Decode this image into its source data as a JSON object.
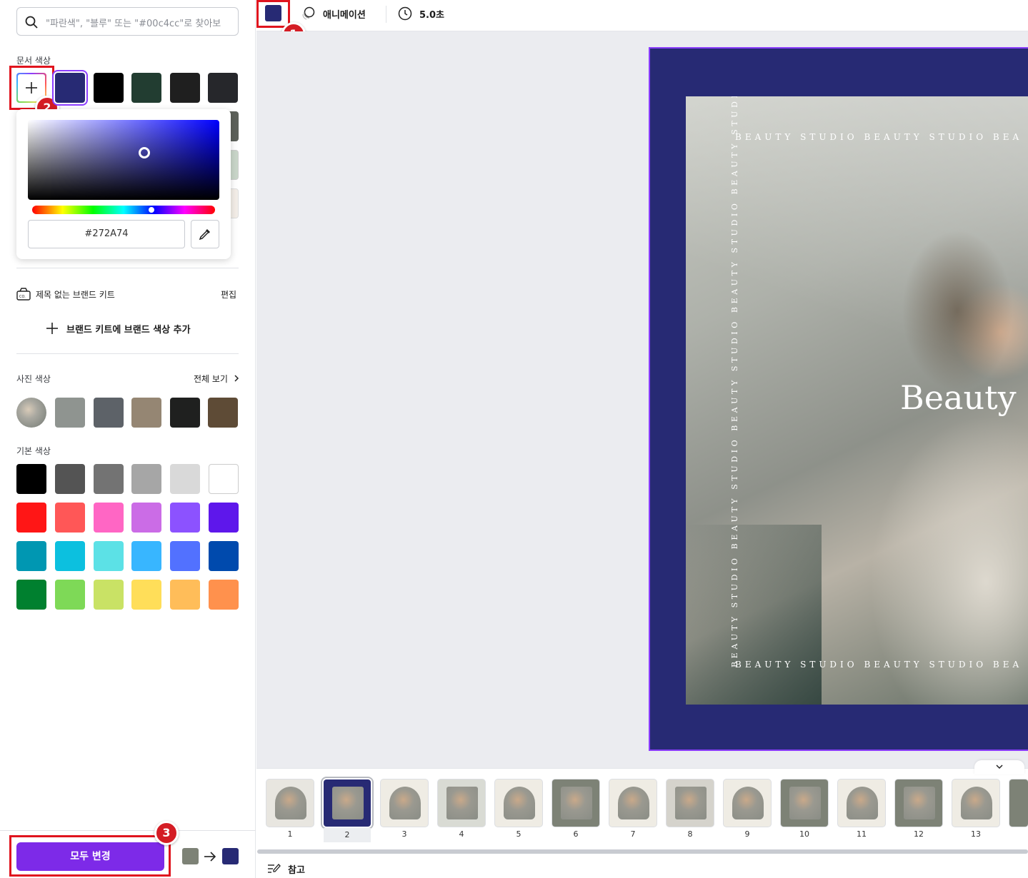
{
  "search": {
    "placeholder": "\"파란색\", \"블루\" 또는 \"#00c4cc\"로 찾아보"
  },
  "doc_colors": {
    "heading": "문서 색상",
    "swatches": [
      "#272a74",
      "#000000",
      "#223d31",
      "#1f1f1f",
      "#26272b"
    ]
  },
  "picker": {
    "hex": "#272A74"
  },
  "brand": {
    "kit_name": "제목 없는 브랜드 키트",
    "edit_label": "편집",
    "add_label": "브랜드 키트에 브랜드 색상 추가"
  },
  "photo_colors": {
    "heading": "사진 색상",
    "view_all": "전체 보기",
    "swatches": [
      "#8f9490",
      "#5d6268",
      "#958673",
      "#1f201f",
      "#5e4b36"
    ]
  },
  "default_colors": {
    "heading": "기본 색상",
    "swatches": [
      "#000000",
      "#545454",
      "#737373",
      "#a6a6a6",
      "#d9d9d9",
      "#ffffff",
      "#ff1616",
      "#ff5757",
      "#ff66c4",
      "#cb6ce6",
      "#8c52ff",
      "#5e17eb",
      "#0097b2",
      "#0cc0df",
      "#5ce1e6",
      "#38b6ff",
      "#5271ff",
      "#004aad",
      "#00802f",
      "#7ed957",
      "#c9e265",
      "#ffde59",
      "#ffbd59",
      "#ff914d"
    ]
  },
  "footer": {
    "change_all": "모두 변경",
    "from_color": "#7d8276",
    "to_color": "#272a74"
  },
  "toolbar": {
    "current_color": "#272a74",
    "animation": "애니메이션",
    "duration": "5.0초"
  },
  "badges": {
    "one": "1",
    "two": "2",
    "three": "3"
  },
  "design": {
    "vertical_text": "BEAUTY STUDIO BEAUTY STUDIO BEAUTY STUDIO BEAUTY STUDIO BEAUTY STUDIO BEAUTY",
    "top_text": "BEAUTY STUDIO BEAUTY STUDIO BEA",
    "bottom_text": "BEAUTY STUDIO BEAUTY STUDIO BEA",
    "title": "Beauty c"
  },
  "pages": [
    "1",
    "2",
    "3",
    "4",
    "5",
    "6",
    "7",
    "8",
    "9",
    "10",
    "11",
    "12",
    "13"
  ],
  "notes": {
    "label": "참고"
  },
  "colors": {
    "accent": "#7d2ae8",
    "highlight": "#e0141e",
    "selection": "#8b3dff"
  }
}
